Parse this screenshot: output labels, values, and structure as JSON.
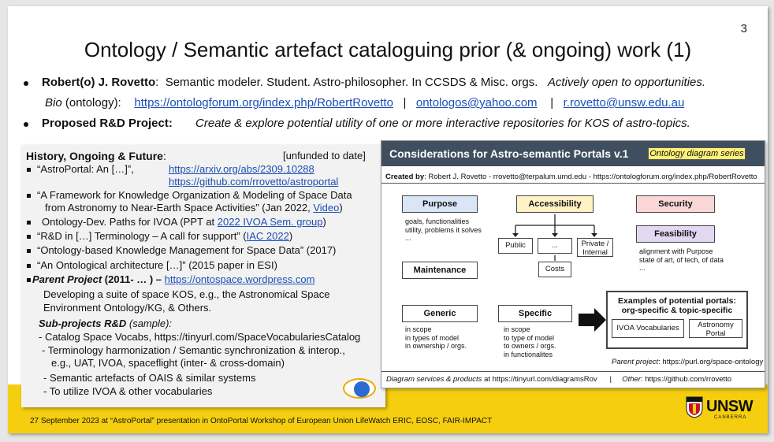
{
  "slide": {
    "page_number": "3",
    "title": "Ontology / Semantic artefact cataloguing prior (& ongoing) work (1)",
    "bullet1": {
      "name": "Robert(o) J. Rovetto",
      "colon": ":",
      "desc": "Semantic modeler. Student. Astro-philosopher.  In CCSDS & Misc. orgs.",
      "open": "Actively open to opportunities."
    },
    "bio": {
      "label": "Bio",
      "suffix": "(ontology):",
      "link1": "https://ontologforum.org/index.php/RobertRovetto",
      "sep1": "|",
      "link2": "ontologos@yahoo.com",
      "sep2": "|",
      "link3": "r.rovetto@unsw.edu.au"
    },
    "bullet2": {
      "label": "Proposed R&D Project:",
      "text": "Create & explore potential utility of one or more interactive repositories for KOS of astro-topics."
    }
  },
  "left": {
    "heading": "History, Ongoing & Future",
    "heading_colon": ":",
    "unfunded": "[unfunded to date]",
    "l1": "“AstroPortal: An […]”,",
    "l1_link1": "https://arxiv.org/abs/2309.10288",
    "l1_link2": "https://github.com/rrovetto/astroportal",
    "l2a": "“A Framework for Knowledge Organization & Modeling of Space Data",
    "l2b": "from Astronomy to Near-Earth Space Activities” (Jan 2022,",
    "l2b_link": "Video",
    "l2b_end": ")",
    "l3": "Ontology-Dev. Paths for IVOA (PPT at",
    "l3_link": "2022 IVOA Sem. group",
    "l3_end": ")",
    "l4": "“R&D in […] Terminology – A call for support” (",
    "l4_link": "IAC 2022",
    "l4_end": ")",
    "l5": "“Ontology-based Knowledge Management for Space Data” (2017)",
    "l6": "“An Ontological architecture […]” (2015 paper in ESI)",
    "parent_label": "Parent Project",
    "parent_years": "(2011- … ) –",
    "parent_link": "https://ontospace.wordpress.com",
    "dev1": "Developing a suite of space KOS, e.g., the Astronomical Space",
    "dev2": "Environment Ontology/KG, & Others.",
    "sub_label": "Sub-projects R&D",
    "sub_sample": "(sample):",
    "s1": "- Catalog Space Vocabs, https://tinyurl.com/SpaceVocabulariesCatalog",
    "s2a": "- Terminology harmonization / Semantic synchronization & interop.,",
    "s2b": "e.g., UAT, IVOA, spaceflight (inter- & cross-domain)",
    "s3": "- Semantic artefacts of OAIS & similar systems",
    "s4": "- To utilize IVOA & other vocabularies"
  },
  "diagram": {
    "title": "Considerations for Astro-semantic Portals v.1",
    "tag": "Ontology diagram series",
    "created_label": "Created by",
    "created_text": ": Robert J. Rovetto - rrovetto@terpalum.umd.edu - https://ontologforum.org/index.php/RobertRovetto",
    "purpose": "Purpose",
    "purpose_items": [
      "goals, functionalities",
      "utility, problems it solves",
      "..."
    ],
    "accessibility": "Accessibility",
    "public": "Public",
    "ellipsis": "...",
    "private_l1": "Private /",
    "private_l2": "Internal",
    "costs": "Costs",
    "security": "Security",
    "feasibility": "Feasibility",
    "feasibility_items": [
      "alignment with Purpose",
      "state of art, of tech, of data",
      "..."
    ],
    "maintenance": "Maintenance",
    "generic": "Generic",
    "generic_items": [
      "in scope",
      "in types of model",
      "in ownership / orgs."
    ],
    "specific": "Specific",
    "specific_items": [
      "in scope",
      "to type of model",
      "to owners / orgs.",
      "in functionalites"
    ],
    "examples_l1": "Examples of potential portals:",
    "examples_l2": "org-specific & topic-specific",
    "ivoa_vocab": "IVOA Vocabularies",
    "astro_l1": "Astronomy",
    "astro_l2": "Portal",
    "parent_label": "Parent project",
    "parent_url": ":  https://purl.org/space-ontology",
    "foot_label": "Diagram services & products",
    "foot_url": " at https://tinyurl.com/diagramsRov",
    "foot_sep": "|",
    "other_label": "Other",
    "other_url": ": https://github.com/rrovetto"
  },
  "footer": {
    "text": "27 September  2023 at “AstroPortal” presentation  in OntoPortal Workshop of European Union LifeWatch ERIC, EOSC, FAIR-IMPACT",
    "logo": "UNSW",
    "logo_sub": "CANBERRA"
  },
  "colors": {
    "yellow_band": "#f5cf0f",
    "header_dark": "#3f4f5f",
    "purpose_blue": "#d9e6f7",
    "access_yellow": "#fff2c4",
    "security_pink": "#fbd6d6",
    "feasibility_purple": "#e3d7f2",
    "link_blue": "#1a4fb5"
  }
}
